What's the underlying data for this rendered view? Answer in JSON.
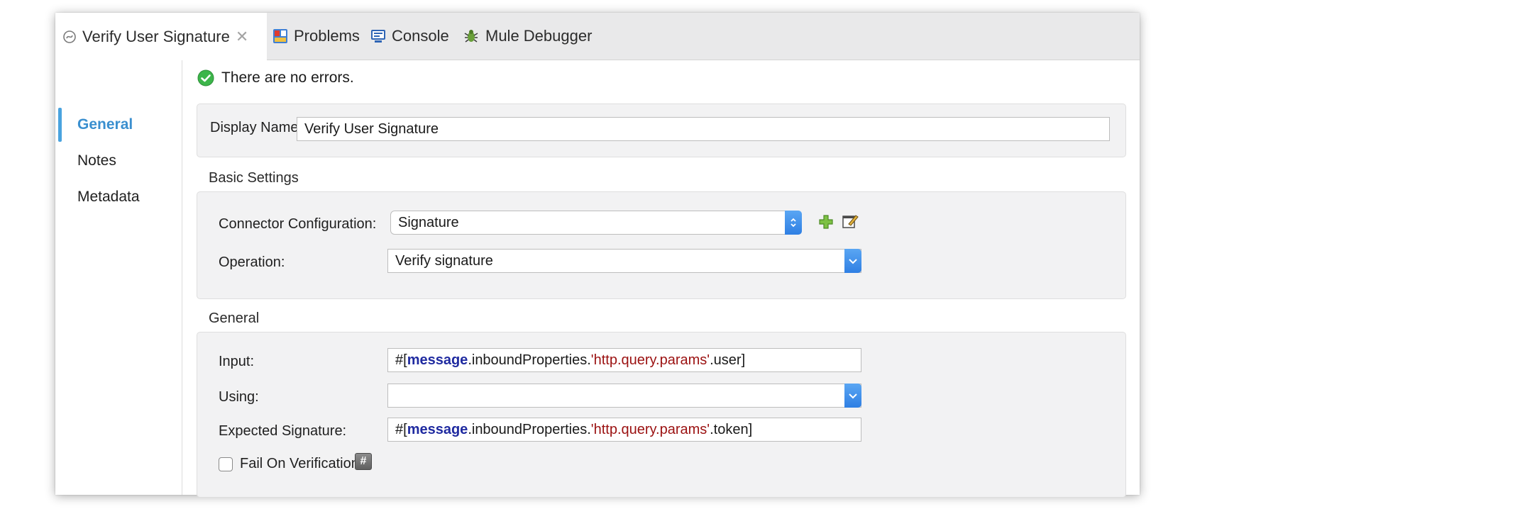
{
  "tabs": [
    {
      "label": "Verify User Signature",
      "icon": "mule-component-icon",
      "active": true
    },
    {
      "label": "Problems",
      "icon": "problems-icon"
    },
    {
      "label": "Console",
      "icon": "console-icon"
    },
    {
      "label": "Mule Debugger",
      "icon": "debug-bug-icon"
    }
  ],
  "sidebar": {
    "items": [
      {
        "label": "General",
        "active": true
      },
      {
        "label": "Notes"
      },
      {
        "label": "Metadata"
      }
    ]
  },
  "status": {
    "text": "There are no errors.",
    "icon": "check-circle-icon"
  },
  "display_name": {
    "label": "Display Name:",
    "value": "Verify User Signature"
  },
  "basic_settings": {
    "title": "Basic Settings",
    "connector_label": "Connector Configuration:",
    "connector_value": "Signature",
    "operation_label": "Operation:",
    "operation_value": "Verify signature"
  },
  "general": {
    "title": "General",
    "input_label": "Input:",
    "input_value": {
      "prefix": "#[",
      "keyword": "message",
      "middle": ".inboundProperties.",
      "string": "'http.query.params'",
      "suffix": ".user]"
    },
    "using_label": "Using:",
    "using_value": "",
    "expected_label": "Expected Signature:",
    "expected_value": {
      "prefix": "#[",
      "keyword": "message",
      "middle": ".inboundProperties.",
      "string": "'http.query.params'",
      "suffix": ".token]"
    },
    "fail_label": "Fail On Verification",
    "fail_checked": false,
    "hash_symbol": "#"
  },
  "colors": {
    "accent": "#4aa3df",
    "select_blue": "#3b8ae8",
    "keyword": "#1f2aa0",
    "string": "#9b1111",
    "ok_green": "#3cb54a"
  }
}
